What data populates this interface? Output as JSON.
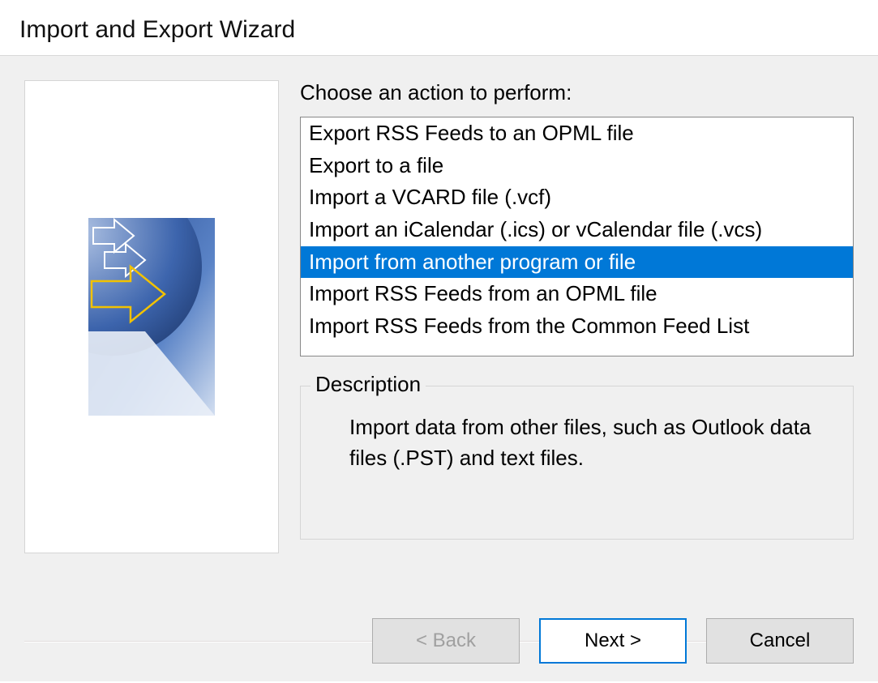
{
  "title": "Import and Export Wizard",
  "prompt": "Choose an action to perform:",
  "actions": [
    "Export RSS Feeds to an OPML file",
    "Export to a file",
    "Import a VCARD file (.vcf)",
    "Import an iCalendar (.ics) or vCalendar file (.vcs)",
    "Import from another program or file",
    "Import RSS Feeds from an OPML file",
    "Import RSS Feeds from the Common Feed List"
  ],
  "selectedIndex": 4,
  "description": {
    "legend": "Description",
    "text": "Import data from other files, such as Outlook data files (.PST) and text files."
  },
  "buttons": {
    "back": "< Back",
    "next": "Next >",
    "cancel": "Cancel"
  }
}
